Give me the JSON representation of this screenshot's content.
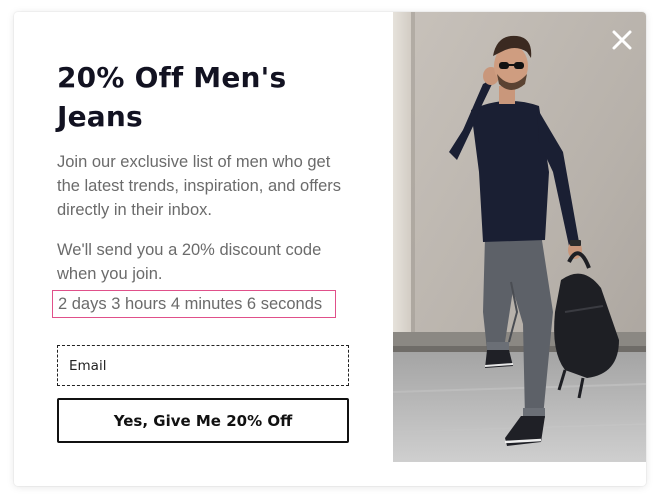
{
  "popup": {
    "title": "20% Off Men's Jeans",
    "description": "Join our exclusive list of men who get the latest trends, inspiration, and offers directly in their inbox.",
    "note": "We'll send you a 20% discount code when you join.",
    "countdown": "2 days 3 hours 4 minutes 6 seconds",
    "email_placeholder": "Email",
    "cta_label": "Yes, Give Me 20% Off",
    "close_icon": "close-icon"
  },
  "colors": {
    "title": "#121221",
    "body_text": "#6b6b6b",
    "countdown_border": "#e0508a",
    "button_border": "#111111"
  }
}
